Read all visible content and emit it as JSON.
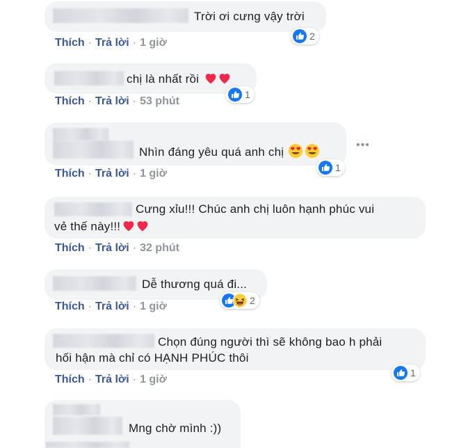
{
  "actions": {
    "like": "Thích",
    "reply": "Trả lời",
    "separator": "·"
  },
  "comments": [
    {
      "text": "Trời ơi cưng vậy trời",
      "time": "1 giờ",
      "reactions": {
        "count": "2",
        "types": [
          "like"
        ]
      }
    },
    {
      "text": "chị là nhất rồi",
      "emoji": [
        "red-heart",
        "red-heart"
      ],
      "time": "53 phút",
      "reactions": {
        "count": "1",
        "types": [
          "like"
        ]
      }
    },
    {
      "text": "Nhìn đáng yêu quá anh chị",
      "emoji": [
        "heart-eyes",
        "heart-eyes"
      ],
      "time": "1 giờ",
      "reactions": {
        "count": "1",
        "types": [
          "like"
        ]
      }
    },
    {
      "text_line1": "Cưng xỉu!!! Chúc anh chị luôn hạnh phúc vui",
      "text_line2": "vẻ thế này!!!",
      "emoji": [
        "red-heart",
        "red-heart"
      ],
      "time": "32 phút"
    },
    {
      "text": "Dễ thương quá đi...",
      "time": "1 giờ",
      "reactions": {
        "count": "2",
        "types": [
          "like",
          "haha"
        ]
      }
    },
    {
      "text_line1": "Chọn đúng người thì sẽ không bao h phải",
      "text_line2": "hối hận mà chỉ có HẠNH PHÚC thôi",
      "time": "1 giờ",
      "reactions": {
        "count": "1",
        "types": [
          "like"
        ]
      }
    },
    {
      "text": "Mng chờ mình :))"
    }
  ],
  "more_options": "•••",
  "colors": {
    "bubble": "#f2f3f5",
    "link": "#385898",
    "meta": "#90949c",
    "like_blue": "#1877f2",
    "heart_red": "#f0284a"
  }
}
